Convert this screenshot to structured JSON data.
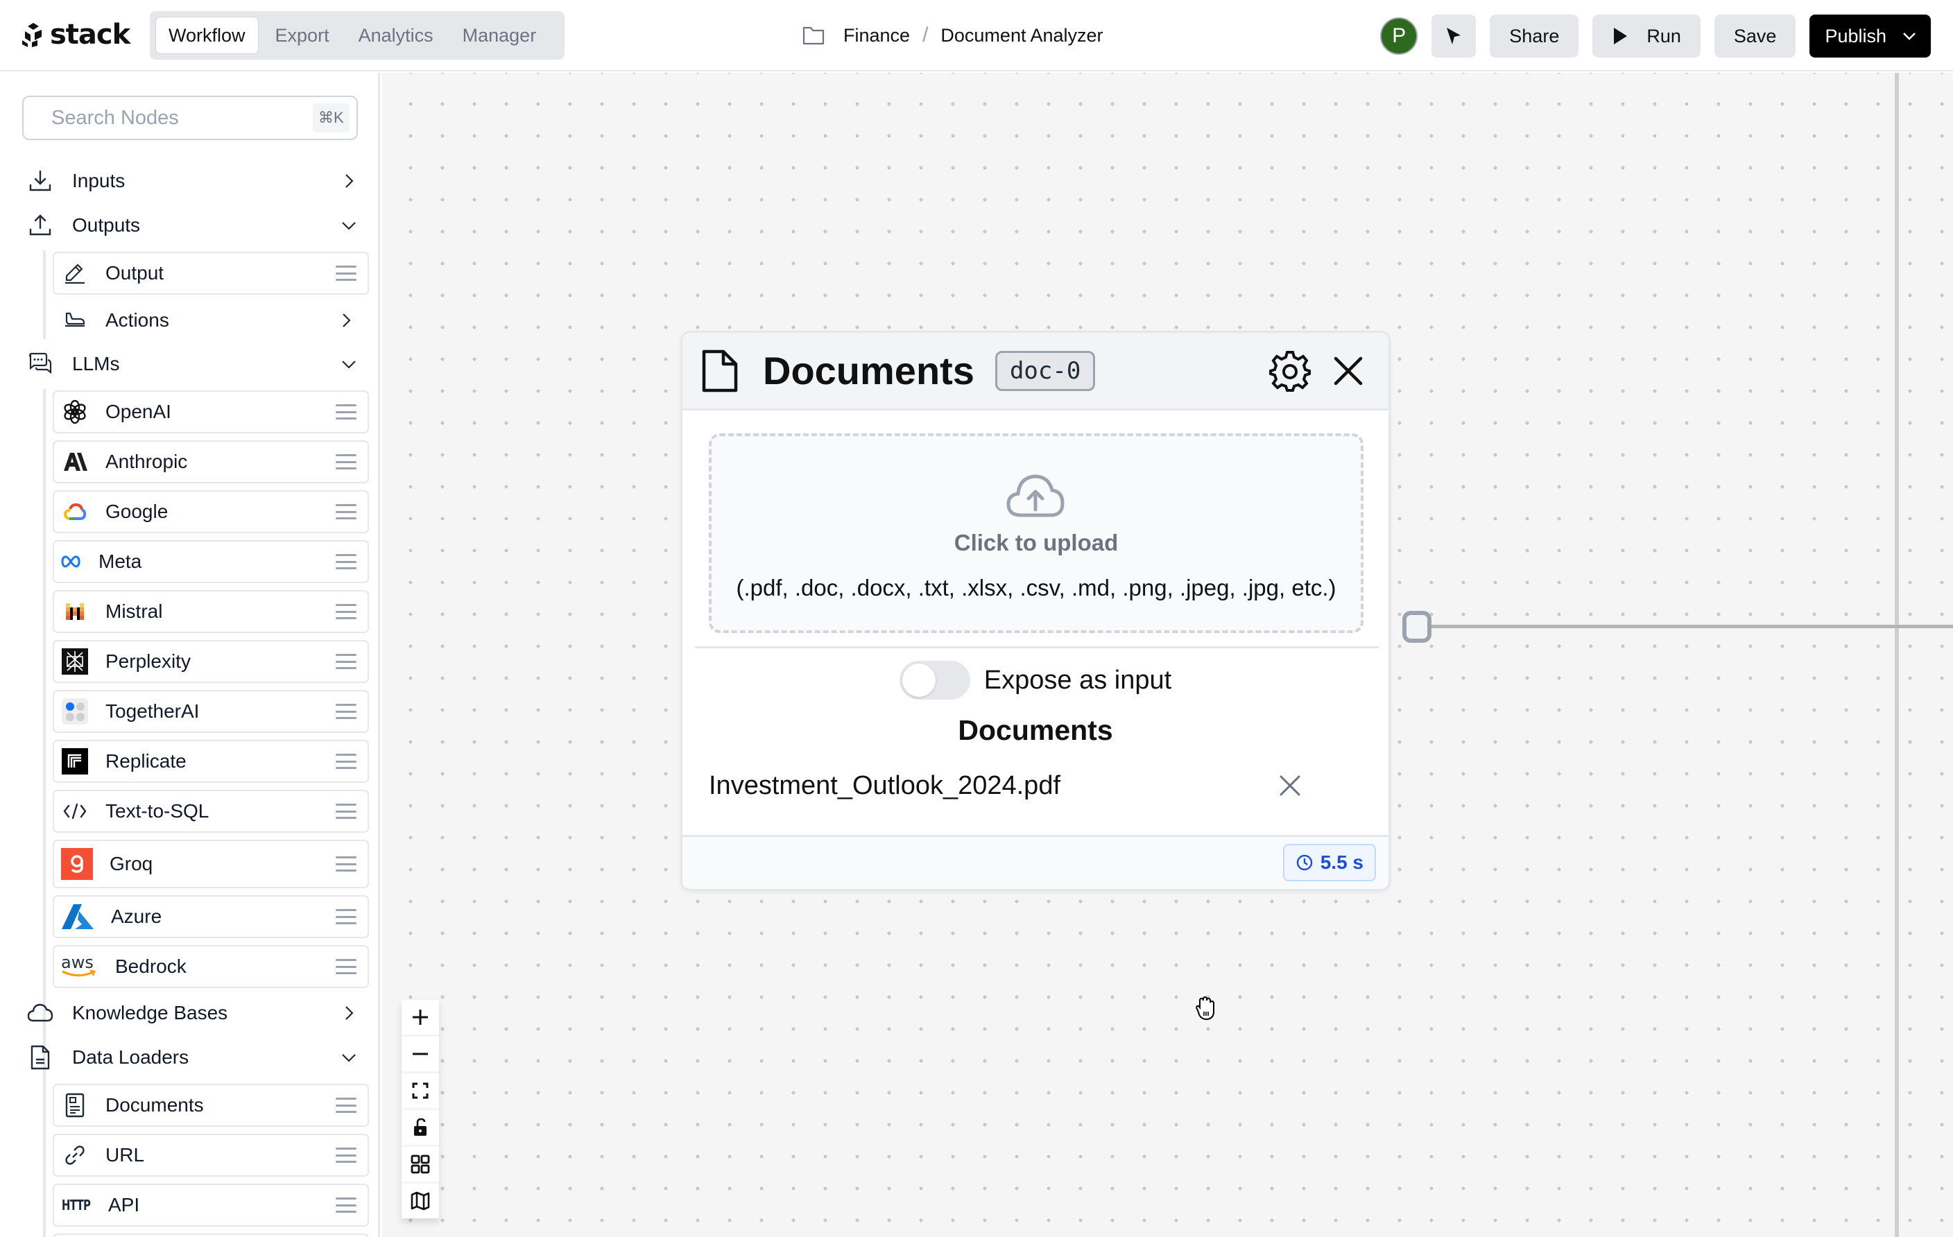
{
  "app": {
    "logo_text": "stack",
    "tabs": [
      {
        "label": "Workflow",
        "active": true
      },
      {
        "label": "Export",
        "active": false
      },
      {
        "label": "Analytics",
        "active": false
      },
      {
        "label": "Manager",
        "active": false
      }
    ],
    "breadcrumb": {
      "folder": "Finance",
      "separator": "/",
      "page": "Document Analyzer"
    },
    "user_initial": "P",
    "actions": {
      "share_label": "Share",
      "run_label": "Run",
      "save_label": "Save",
      "publish_label": "Publish"
    }
  },
  "sidebar": {
    "search_placeholder": "Search Nodes",
    "search_shortcut": "⌘K",
    "categories": {
      "inputs": "Inputs",
      "outputs": "Outputs",
      "llms": "LLMs",
      "knowledge_bases": "Knowledge Bases",
      "data_loaders": "Data Loaders"
    },
    "outputs_items": [
      {
        "label": "Output",
        "icon": "pencil-icon"
      },
      {
        "label": "Actions",
        "icon": "actions-icon"
      }
    ],
    "llm_items": [
      {
        "label": "OpenAI",
        "icon": "openai-icon"
      },
      {
        "label": "Anthropic",
        "icon": "anthropic-icon"
      },
      {
        "label": "Google",
        "icon": "google-cloud-icon"
      },
      {
        "label": "Meta",
        "icon": "meta-icon"
      },
      {
        "label": "Mistral",
        "icon": "mistral-icon"
      },
      {
        "label": "Perplexity",
        "icon": "perplexity-icon"
      },
      {
        "label": "TogetherAI",
        "icon": "togetherai-icon"
      },
      {
        "label": "Replicate",
        "icon": "replicate-icon"
      },
      {
        "label": "Text-to-SQL",
        "icon": "code-icon"
      },
      {
        "label": "Groq",
        "icon": "groq-icon"
      },
      {
        "label": "Azure",
        "icon": "azure-icon"
      },
      {
        "label": "Bedrock",
        "icon": "aws-icon"
      }
    ],
    "data_loader_items": [
      {
        "label": "Documents",
        "icon": "document-icon"
      },
      {
        "label": "URL",
        "icon": "link-icon"
      },
      {
        "label": "API",
        "icon": "http-icon"
      }
    ],
    "icon_labels": {
      "http": "HTTP",
      "aws": "aws"
    }
  },
  "node": {
    "title": "Documents",
    "id_badge": "doc-0",
    "upload_title": "Click to upload",
    "upload_formats": "(.pdf, .doc, .docx, .txt, .xlsx, .csv, .md, .png, .jpeg, .jpg, etc.)",
    "expose_label": "Expose as input",
    "expose_enabled": false,
    "documents_heading": "Documents",
    "files": [
      "Investment_Outlook_2024.pdf"
    ],
    "timing": "5.5 s"
  },
  "colors": {
    "avatar": "#2d6a1e",
    "publish_bg": "#000000",
    "timing_text": "#1d4ed8",
    "canvas_bg": "#f5f5f5"
  }
}
